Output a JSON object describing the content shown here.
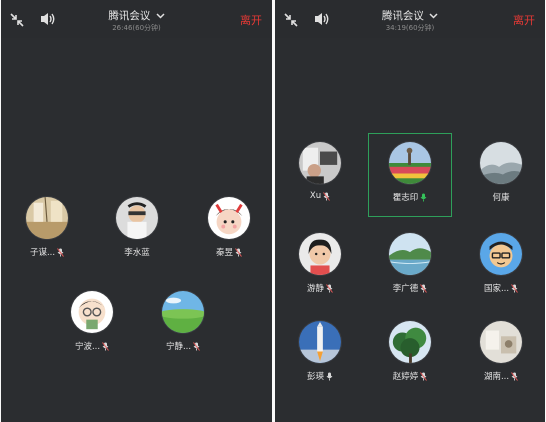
{
  "left": {
    "title": "腾讯会议",
    "timer": "26:46(60分钟)",
    "leave": "离开",
    "participants": [
      {
        "name": "子谋...",
        "mic": "muted",
        "avatar": "warm-room"
      },
      {
        "name": "李水蓝",
        "mic": "none",
        "avatar": "child"
      },
      {
        "name": "秦昱",
        "mic": "muted",
        "avatar": "cartoon-girl"
      },
      {
        "name": "宁波...",
        "mic": "muted",
        "avatar": "cartoon-face"
      },
      {
        "name": "宁静...",
        "mic": "muted",
        "avatar": "green-field"
      }
    ]
  },
  "right": {
    "title": "腾讯会议",
    "timer": "34:19(60分钟)",
    "leave": "离开",
    "participants": [
      {
        "name": "Xu",
        "mic": "muted",
        "avatar": "person-indoor"
      },
      {
        "name": "瞿志印",
        "mic": "active",
        "avatar": "flower-field"
      },
      {
        "name": "何康",
        "mic": "none",
        "avatar": "misty-landscape"
      },
      {
        "name": "游静",
        "mic": "muted",
        "avatar": "woman"
      },
      {
        "name": "李广德",
        "mic": "muted",
        "avatar": "lake-landscape"
      },
      {
        "name": "国家...",
        "mic": "muted",
        "avatar": "cartoon-glasses"
      },
      {
        "name": "彭瑛",
        "mic": "on",
        "avatar": "rocket"
      },
      {
        "name": "赵婷婷",
        "mic": "muted",
        "avatar": "trees"
      },
      {
        "name": "湖南...",
        "mic": "muted",
        "avatar": "objects"
      }
    ]
  },
  "colors": {
    "leave": "#e53935",
    "active_mic": "#35c25a",
    "muted_mic": "#e35a5a",
    "highlight": "#2e9f5a"
  }
}
